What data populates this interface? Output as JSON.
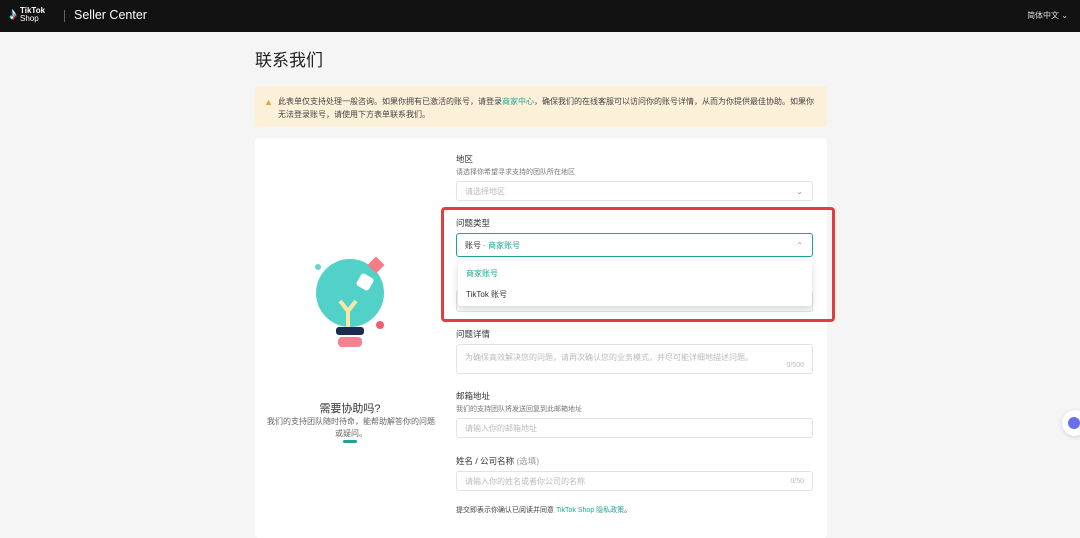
{
  "header": {
    "logo_line1": "TikTok",
    "logo_line2": "Shop",
    "app_title": "Seller Center",
    "language": "简体中文 ⌄"
  },
  "page": {
    "title": "联系我们"
  },
  "notice": {
    "text_before": "此表单仅支持处理一般咨询。如果你拥有已激活的账号，请登录",
    "link": "商家中心",
    "text_after": "，确保我们的在线客服可以访问你的账号详情，从而为你提供最佳协助。如果你无法登录账号，请使用下方表单联系我们。"
  },
  "help": {
    "title": "需要协助吗?",
    "desc": "我们的支持团队随时待命，能帮助解答你的问题或疑问。"
  },
  "form": {
    "region": {
      "label": "地区",
      "hint": "请选择你希望寻求支持的团队所在地区",
      "placeholder": "请选择地区"
    },
    "issue_type": {
      "label": "问题类型",
      "value_prefix": "账号",
      "value_sep": " - ",
      "value": "商家账号",
      "options": [
        "商家账号",
        "TikTok 账号"
      ]
    },
    "details": {
      "label": "问题详情",
      "placeholder": "为确保高效解决您的问题，请再次确认您的业务模式，并尽可能详细地描述问题。",
      "counter": "0/500"
    },
    "email": {
      "label": "邮箱地址",
      "hint": "我们的支持团队将发送回复到此邮箱地址",
      "placeholder": "请输入你的邮箱地址"
    },
    "name": {
      "label": "姓名 / 公司名称",
      "optional": "(选填)",
      "placeholder": "请输入你的姓名或者你公司的名称",
      "counter": "0/50"
    },
    "footer_before": "提交即表示你确认已阅读并同意 ",
    "footer_link": "TikTok Shop 隐私政策",
    "footer_after": "。"
  },
  "colors": {
    "accent": "#1fa394",
    "highlight": "#e0403d",
    "warning_bg": "#fdf0d9"
  }
}
